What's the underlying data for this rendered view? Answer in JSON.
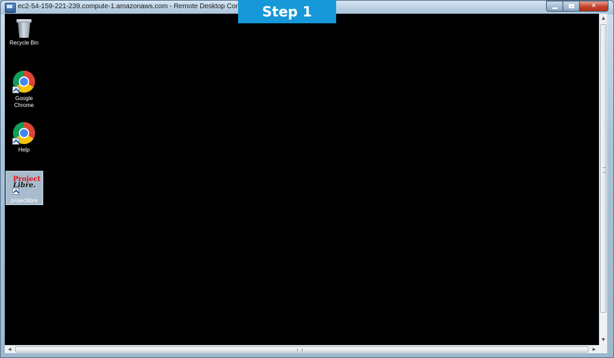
{
  "window": {
    "title": "ec2-54-159-221-239.compute-1.amazonaws.com - Remote Desktop Connection"
  },
  "banner": {
    "text": "Step 1",
    "color": "#1597d8"
  },
  "desktop": {
    "background": "#000000",
    "icons": [
      {
        "label": "Recycle Bin",
        "icon": "recycle-bin-icon"
      },
      {
        "label": "Google Chrome",
        "line1": "Google",
        "line2": "Chrome",
        "icon": "chrome-icon"
      },
      {
        "label": "Help",
        "icon": "chrome-icon"
      },
      {
        "label": "projectlibre",
        "icon": "projectlibre-icon",
        "logo_line1": "Project",
        "logo_line2": "Libre.",
        "selected": true
      }
    ]
  },
  "controls": {
    "minimize": "minimize",
    "maximize": "maximize",
    "close": "close"
  }
}
